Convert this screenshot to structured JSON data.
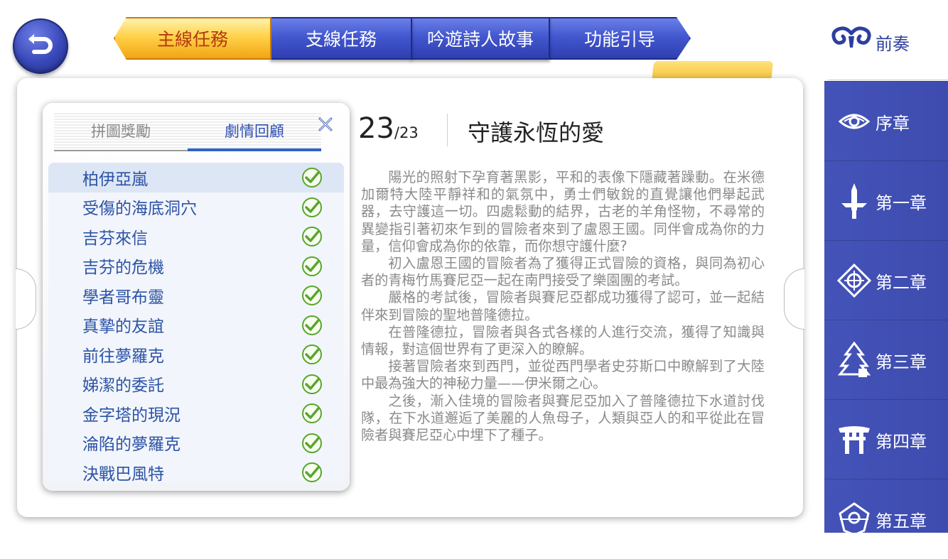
{
  "header": {
    "tabs": [
      {
        "label": "主線任務",
        "active": true
      },
      {
        "label": "支線任務",
        "active": false
      },
      {
        "label": "吟遊詩人故事",
        "active": false
      },
      {
        "label": "功能引导",
        "active": false
      }
    ]
  },
  "popup": {
    "tab_puzzle": "拼圖獎勵",
    "tab_story": "劇情回顧",
    "close_icon": "close-icon",
    "quests": [
      "柏伊亞嵐",
      "受傷的海底洞穴",
      "吉芬來信",
      "吉芬的危機",
      "學者哥布靈",
      "真摯的友誼",
      "前往夢羅克",
      "娣潔的委託",
      "金字塔的現況",
      "淪陷的夢羅克",
      "決戰巴風特"
    ]
  },
  "chapter": {
    "number": "23",
    "total": "/23",
    "title": "守護永恆的愛",
    "paragraphs": [
      "陽光的照射下孕育著黑影，平和的表像下隱藏著躁動。在米德加爾特大陸平靜祥和的氣氛中，勇士們敏銳的直覺讓他們舉起武器，去守護這一切。四處鬆動的結界，古老的羊角怪物，不尋常的異變指引著初來乍到的冒險者來到了盧恩王國。同伴會成為你的力量，信仰會成為你的依靠，而你想守護什麼?",
      "初入盧恩王國的冒險者為了獲得正式冒險的資格，與同為初心者的青梅竹馬賽尼亞一起在南門接受了樂園團的考試。",
      "嚴格的考試後，冒險者與賽尼亞都成功獲得了認可，並一起結伴來到冒險的聖地普隆德拉。",
      "在普隆德拉，冒險者與各式各樣的人進行交流，獲得了知識與情報，對這個世界有了更深入的瞭解。",
      "接著冒險者來到西門，並從西門學者史芬斯口中瞭解到了大陸中最為強大的神秘力量——伊米爾之心。",
      "之後，漸入佳境的冒險者與賽尼亞加入了普隆德拉下水道討伐隊，在下水道邂逅了美麗的人魚母子，人類與亞人的和平從此在冒險者與賽尼亞心中埋下了種子。"
    ]
  },
  "sidebar": {
    "items": [
      {
        "label": "前奏",
        "icon": "ram-horns-icon",
        "active": true
      },
      {
        "label": "序章",
        "icon": "eye-icon",
        "active": false
      },
      {
        "label": "第一章",
        "icon": "sword-icon",
        "active": false
      },
      {
        "label": "第二章",
        "icon": "compass-icon",
        "active": false
      },
      {
        "label": "第三章",
        "icon": "tree-icon",
        "active": false
      },
      {
        "label": "第四章",
        "icon": "torii-icon",
        "active": false
      },
      {
        "label": "第五章",
        "icon": "crest-icon",
        "active": false
      }
    ]
  },
  "colors": {
    "accent_blue": "#3e4caf",
    "gold": "#ffd24a",
    "check_green": "#58a82a",
    "list_text": "#2b53a6"
  }
}
